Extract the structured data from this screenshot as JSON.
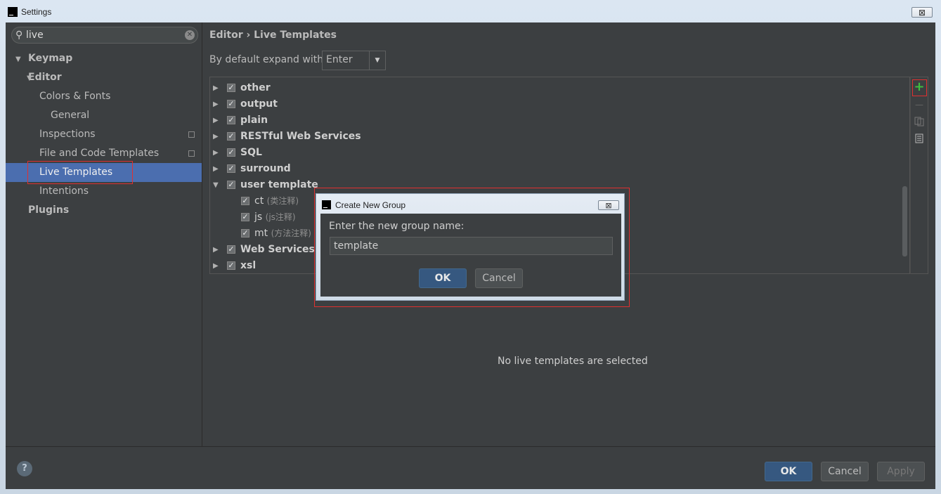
{
  "window": {
    "title": "Settings",
    "close_glyph": "⊠",
    "app_icon": "intellij-icon"
  },
  "search": {
    "value": "live",
    "placeholder": ""
  },
  "sidebar": {
    "items": [
      {
        "label": "Keymap"
      },
      {
        "label": "Editor",
        "expanded": true
      },
      {
        "label": "Colors & Fonts",
        "expanded": true
      },
      {
        "label": "General"
      },
      {
        "label": "Inspections"
      },
      {
        "label": "File and Code Templates"
      },
      {
        "label": "Live Templates",
        "selected": true
      },
      {
        "label": "Intentions"
      },
      {
        "label": "Plugins"
      }
    ]
  },
  "breadcrumb": {
    "part1": "Editor",
    "sep": "›",
    "part2": "Live Templates"
  },
  "expand": {
    "label": "By default expand with",
    "selected": "Enter"
  },
  "groups": [
    {
      "label": "other",
      "checked": true
    },
    {
      "label": "output",
      "checked": true
    },
    {
      "label": "plain",
      "checked": true
    },
    {
      "label": "RESTful Web Services",
      "checked": true
    },
    {
      "label": "SQL",
      "checked": true
    },
    {
      "label": "surround",
      "checked": true
    },
    {
      "label": "user template",
      "checked": true,
      "expanded": true
    },
    {
      "label": "Web Services",
      "checked": true
    },
    {
      "label": "xsl",
      "checked": true
    }
  ],
  "user_templates": [
    {
      "abbr": "ct",
      "desc": "(类注释)"
    },
    {
      "abbr": "js",
      "desc": "(js注释)"
    },
    {
      "abbr": "mt",
      "desc": "(方法注释)"
    }
  ],
  "toolbar": {
    "add": "+",
    "remove": "—",
    "copy": "copy-icon",
    "restore": "restore-icon"
  },
  "empty_message": "No live templates are selected",
  "dialog": {
    "title": "Create New Group",
    "prompt": "Enter the new group name:",
    "value": "template",
    "ok": "OK",
    "cancel": "Cancel"
  },
  "footer": {
    "help": "?",
    "ok": "OK",
    "cancel": "Cancel",
    "apply": "Apply"
  },
  "colors": {
    "background": "#3c3f41",
    "selection": "#4b6eaf",
    "highlight": "#e03030",
    "add": "#3fbf3f"
  }
}
